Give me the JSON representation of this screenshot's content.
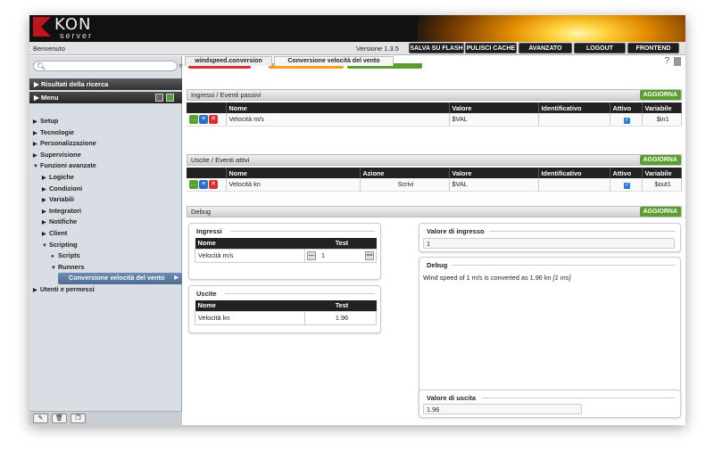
{
  "brand": {
    "letter": "KON",
    "sub": "server"
  },
  "topbar": {
    "welcome": "Benvenuto",
    "version": "Versione 1.3.5",
    "buttons": [
      "SALVA SU FLASH",
      "PULISCI CACHE",
      "AVANZATO",
      "LOGOUT",
      "FRONTEND"
    ]
  },
  "sidebar": {
    "search_placeholder": "",
    "results_label": "Risultati della ricerca",
    "menu_label": "Menu",
    "tree": [
      {
        "label": "Setup",
        "level": 0,
        "arrow": "▶"
      },
      {
        "label": "Tecnologie",
        "level": 0,
        "arrow": "▶"
      },
      {
        "label": "Personalizzazione",
        "level": 0,
        "arrow": "▶"
      },
      {
        "label": "Supervisione",
        "level": 0,
        "arrow": "▶"
      },
      {
        "label": "Funzioni avanzate",
        "level": 0,
        "arrow": "▼"
      },
      {
        "label": "Logiche",
        "level": 1,
        "arrow": "▶"
      },
      {
        "label": "Condizioni",
        "level": 1,
        "arrow": "▶"
      },
      {
        "label": "Variabili",
        "level": 1,
        "arrow": "▶"
      },
      {
        "label": "Integratori",
        "level": 1,
        "arrow": "▶"
      },
      {
        "label": "Notifiche",
        "level": 1,
        "arrow": "▶"
      },
      {
        "label": "Client",
        "level": 1,
        "arrow": "▶"
      },
      {
        "label": "Scripting",
        "level": 1,
        "arrow": "▼"
      },
      {
        "label": "Scripts",
        "level": 2,
        "arrow": "●"
      },
      {
        "label": "Runners",
        "level": 2,
        "arrow": "▼"
      },
      {
        "label": "Conversione velocità del vento",
        "level": 3,
        "arrow": "",
        "selected": true
      },
      {
        "label": "Utenti e permessi",
        "level": 0,
        "arrow": "▶"
      }
    ]
  },
  "tabs": [
    "windspeed.conversion",
    "Conversione velocità del vento"
  ],
  "colors": {
    "green": "#5a9e2d",
    "red": "#d9302b",
    "blue_btn": "#2a6fcc",
    "dark": "#222222"
  },
  "inputs_section": {
    "title": "Ingressi / Eventi passivi",
    "refresh": "AGGIORNA",
    "headers": [
      "Nome",
      "Valore",
      "Identificativo",
      "Attivo",
      "Variabile"
    ],
    "rows": [
      {
        "nome": "Velocità m/s",
        "valore": "$VAL",
        "id": "",
        "attivo": "✓",
        "variabile": "$in1"
      }
    ]
  },
  "outputs_section": {
    "title": "Uscite / Eventi attivi",
    "refresh": "AGGIORNA",
    "headers": [
      "Nome",
      "Azione",
      "Valore",
      "Identificativo",
      "Attivo",
      "Variabile"
    ],
    "rows": [
      {
        "nome": "Velocità kn",
        "azione": "Scrivi",
        "valore": "$VAL",
        "id": "",
        "attivo": "✓",
        "variabile": "$out1"
      }
    ]
  },
  "debug_section": {
    "title": "Debug",
    "refresh": "AGGIORNA",
    "ingressi": {
      "title": "Ingressi",
      "headers": [
        "Nome",
        "Test"
      ],
      "rows": [
        {
          "nome": "Velocità m/s",
          "test": "1"
        }
      ]
    },
    "uscite": {
      "title": "Uscite",
      "headers": [
        "Nome",
        "Test"
      ],
      "rows": [
        {
          "nome": "Velocità kn",
          "test": "1.96"
        }
      ]
    },
    "input_value": {
      "title": "Valore di ingresso",
      "value": "1"
    },
    "debug": {
      "title": "Debug",
      "text": "Wind speed of 1 m/s is converted as 1.96 kn",
      "time": "[1 ms]"
    },
    "output_value": {
      "title": "Valore di uscita",
      "value": "1.96"
    }
  }
}
